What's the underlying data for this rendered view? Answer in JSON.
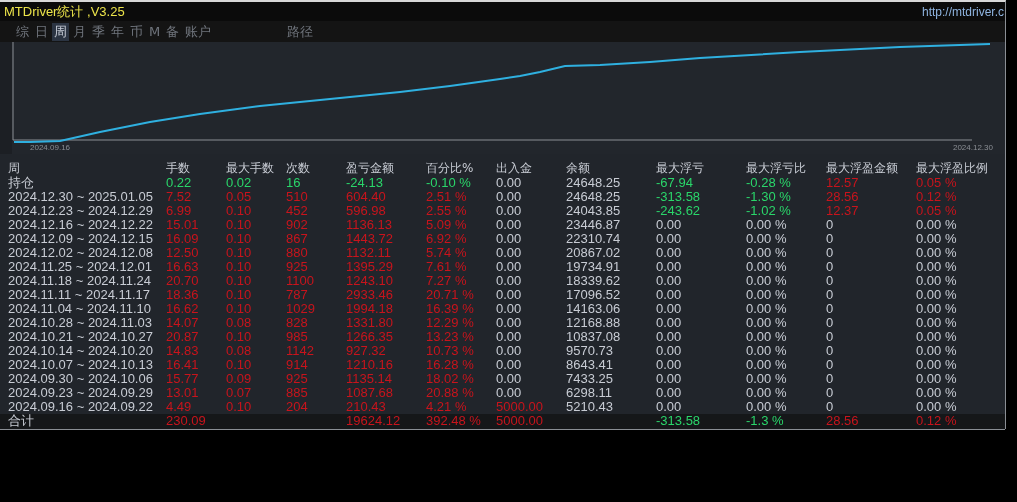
{
  "window": {
    "title": "MTDriver统计 ,V3.25",
    "url": "http://mtdriver.c"
  },
  "tabs": [
    {
      "label": "综",
      "selected": false
    },
    {
      "label": "日",
      "selected": false
    },
    {
      "label": "周",
      "selected": true
    },
    {
      "label": "月",
      "selected": false
    },
    {
      "label": "季",
      "selected": false
    },
    {
      "label": "年",
      "selected": false
    },
    {
      "label": "币",
      "selected": false
    },
    {
      "label": "M",
      "selected": false
    },
    {
      "label": "备",
      "selected": false
    },
    {
      "label": "账户",
      "selected": false
    },
    {
      "label": "路径",
      "selected": false
    }
  ],
  "chart": {
    "start_label": "2024.09.16",
    "end_label": "2024.12.30"
  },
  "table": {
    "columns": [
      "周",
      "手数",
      "最大手数",
      "次数",
      "盈亏金额",
      "百分比%",
      "出入金",
      "余额",
      "最大浮亏",
      "最大浮亏比",
      "最大浮盈金额",
      "最大浮盈比例"
    ],
    "rows": [
      {
        "cells": [
          "持仓",
          {
            "text": "0.22",
            "color": "#2ad66a"
          },
          {
            "text": "0.02",
            "color": "#2ad66a"
          },
          {
            "text": "16",
            "color": "#2ad66a"
          },
          {
            "text": "-24.13",
            "color": "#2ad66a"
          },
          {
            "text": "-0.10 %",
            "color": "#2ad66a"
          },
          {
            "text": "0.00",
            "color": "#c8ccd4"
          },
          {
            "text": "24648.25",
            "color": "#c8ccd4"
          },
          {
            "text": "-67.94",
            "color": "#2ad66a"
          },
          {
            "text": "-0.28 %",
            "color": "#2ad66a"
          },
          {
            "text": "12.57",
            "color": "#c8141c"
          },
          {
            "text": "0.05 %",
            "color": "#c8141c"
          }
        ]
      },
      {
        "cells": [
          "2024.12.30 ~ 2025.01.05",
          {
            "text": "7.52",
            "color": "#c8141c"
          },
          {
            "text": "0.05",
            "color": "#c8141c"
          },
          {
            "text": "510",
            "color": "#c8141c"
          },
          {
            "text": "604.40",
            "color": "#c8141c"
          },
          {
            "text": "2.51 %",
            "color": "#c8141c"
          },
          {
            "text": "0.00",
            "color": "#c8ccd4"
          },
          {
            "text": "24648.25",
            "color": "#c8ccd4"
          },
          {
            "text": "-313.58",
            "color": "#2ad66a"
          },
          {
            "text": "-1.30 %",
            "color": "#2ad66a"
          },
          {
            "text": "28.56",
            "color": "#c8141c"
          },
          {
            "text": "0.12 %",
            "color": "#c8141c"
          }
        ]
      },
      {
        "cells": [
          "2024.12.23 ~ 2024.12.29",
          {
            "text": "6.99",
            "color": "#c8141c"
          },
          {
            "text": "0.10",
            "color": "#c8141c"
          },
          {
            "text": "452",
            "color": "#c8141c"
          },
          {
            "text": "596.98",
            "color": "#c8141c"
          },
          {
            "text": "2.55 %",
            "color": "#c8141c"
          },
          {
            "text": "0.00",
            "color": "#c8ccd4"
          },
          {
            "text": "24043.85",
            "color": "#c8ccd4"
          },
          {
            "text": "-243.62",
            "color": "#2ad66a"
          },
          {
            "text": "-1.02 %",
            "color": "#2ad66a"
          },
          {
            "text": "12.37",
            "color": "#c8141c"
          },
          {
            "text": "0.05 %",
            "color": "#c8141c"
          }
        ]
      },
      {
        "cells": [
          "2024.12.16 ~ 2024.12.22",
          {
            "text": "15.01",
            "color": "#c8141c"
          },
          {
            "text": "0.10",
            "color": "#c8141c"
          },
          {
            "text": "902",
            "color": "#c8141c"
          },
          {
            "text": "1136.13",
            "color": "#c8141c"
          },
          {
            "text": "5.09 %",
            "color": "#c8141c"
          },
          {
            "text": "0.00",
            "color": "#c8ccd4"
          },
          {
            "text": "23446.87",
            "color": "#c8ccd4"
          },
          {
            "text": "0.00",
            "color": "#c8ccd4"
          },
          {
            "text": "0.00 %",
            "color": "#c8ccd4"
          },
          {
            "text": "0",
            "color": "#c8ccd4"
          },
          {
            "text": "0.00 %",
            "color": "#c8ccd4"
          }
        ]
      },
      {
        "cells": [
          "2024.12.09 ~ 2024.12.15",
          {
            "text": "16.09",
            "color": "#c8141c"
          },
          {
            "text": "0.10",
            "color": "#c8141c"
          },
          {
            "text": "867",
            "color": "#c8141c"
          },
          {
            "text": "1443.72",
            "color": "#c8141c"
          },
          {
            "text": "6.92 %",
            "color": "#c8141c"
          },
          {
            "text": "0.00",
            "color": "#c8ccd4"
          },
          {
            "text": "22310.74",
            "color": "#c8ccd4"
          },
          {
            "text": "0.00",
            "color": "#c8ccd4"
          },
          {
            "text": "0.00 %",
            "color": "#c8ccd4"
          },
          {
            "text": "0",
            "color": "#c8ccd4"
          },
          {
            "text": "0.00 %",
            "color": "#c8ccd4"
          }
        ]
      },
      {
        "cells": [
          "2024.12.02 ~ 2024.12.08",
          {
            "text": "12.50",
            "color": "#c8141c"
          },
          {
            "text": "0.10",
            "color": "#c8141c"
          },
          {
            "text": "880",
            "color": "#c8141c"
          },
          {
            "text": "1132.11",
            "color": "#c8141c"
          },
          {
            "text": "5.74 %",
            "color": "#c8141c"
          },
          {
            "text": "0.00",
            "color": "#c8ccd4"
          },
          {
            "text": "20867.02",
            "color": "#c8ccd4"
          },
          {
            "text": "0.00",
            "color": "#c8ccd4"
          },
          {
            "text": "0.00 %",
            "color": "#c8ccd4"
          },
          {
            "text": "0",
            "color": "#c8ccd4"
          },
          {
            "text": "0.00 %",
            "color": "#c8ccd4"
          }
        ]
      },
      {
        "cells": [
          "2024.11.25 ~ 2024.12.01",
          {
            "text": "16.63",
            "color": "#c8141c"
          },
          {
            "text": "0.10",
            "color": "#c8141c"
          },
          {
            "text": "925",
            "color": "#c8141c"
          },
          {
            "text": "1395.29",
            "color": "#c8141c"
          },
          {
            "text": "7.61 %",
            "color": "#c8141c"
          },
          {
            "text": "0.00",
            "color": "#c8ccd4"
          },
          {
            "text": "19734.91",
            "color": "#c8ccd4"
          },
          {
            "text": "0.00",
            "color": "#c8ccd4"
          },
          {
            "text": "0.00 %",
            "color": "#c8ccd4"
          },
          {
            "text": "0",
            "color": "#c8ccd4"
          },
          {
            "text": "0.00 %",
            "color": "#c8ccd4"
          }
        ]
      },
      {
        "cells": [
          "2024.11.18 ~ 2024.11.24",
          {
            "text": "20.70",
            "color": "#c8141c"
          },
          {
            "text": "0.10",
            "color": "#c8141c"
          },
          {
            "text": "1100",
            "color": "#c8141c"
          },
          {
            "text": "1243.10",
            "color": "#c8141c"
          },
          {
            "text": "7.27 %",
            "color": "#c8141c"
          },
          {
            "text": "0.00",
            "color": "#c8ccd4"
          },
          {
            "text": "18339.62",
            "color": "#c8ccd4"
          },
          {
            "text": "0.00",
            "color": "#c8ccd4"
          },
          {
            "text": "0.00 %",
            "color": "#c8ccd4"
          },
          {
            "text": "0",
            "color": "#c8ccd4"
          },
          {
            "text": "0.00 %",
            "color": "#c8ccd4"
          }
        ]
      },
      {
        "cells": [
          "2024.11.11 ~ 2024.11.17",
          {
            "text": "18.36",
            "color": "#c8141c"
          },
          {
            "text": "0.10",
            "color": "#c8141c"
          },
          {
            "text": "787",
            "color": "#c8141c"
          },
          {
            "text": "2933.46",
            "color": "#c8141c"
          },
          {
            "text": "20.71 %",
            "color": "#c8141c"
          },
          {
            "text": "0.00",
            "color": "#c8ccd4"
          },
          {
            "text": "17096.52",
            "color": "#c8ccd4"
          },
          {
            "text": "0.00",
            "color": "#c8ccd4"
          },
          {
            "text": "0.00 %",
            "color": "#c8ccd4"
          },
          {
            "text": "0",
            "color": "#c8ccd4"
          },
          {
            "text": "0.00 %",
            "color": "#c8ccd4"
          }
        ]
      },
      {
        "cells": [
          "2024.11.04 ~ 2024.11.10",
          {
            "text": "16.62",
            "color": "#c8141c"
          },
          {
            "text": "0.10",
            "color": "#c8141c"
          },
          {
            "text": "1029",
            "color": "#c8141c"
          },
          {
            "text": "1994.18",
            "color": "#c8141c"
          },
          {
            "text": "16.39 %",
            "color": "#c8141c"
          },
          {
            "text": "0.00",
            "color": "#c8ccd4"
          },
          {
            "text": "14163.06",
            "color": "#c8ccd4"
          },
          {
            "text": "0.00",
            "color": "#c8ccd4"
          },
          {
            "text": "0.00 %",
            "color": "#c8ccd4"
          },
          {
            "text": "0",
            "color": "#c8ccd4"
          },
          {
            "text": "0.00 %",
            "color": "#c8ccd4"
          }
        ]
      },
      {
        "cells": [
          "2024.10.28 ~ 2024.11.03",
          {
            "text": "14.07",
            "color": "#c8141c"
          },
          {
            "text": "0.08",
            "color": "#c8141c"
          },
          {
            "text": "828",
            "color": "#c8141c"
          },
          {
            "text": "1331.80",
            "color": "#c8141c"
          },
          {
            "text": "12.29 %",
            "color": "#c8141c"
          },
          {
            "text": "0.00",
            "color": "#c8ccd4"
          },
          {
            "text": "12168.88",
            "color": "#c8ccd4"
          },
          {
            "text": "0.00",
            "color": "#c8ccd4"
          },
          {
            "text": "0.00 %",
            "color": "#c8ccd4"
          },
          {
            "text": "0",
            "color": "#c8ccd4"
          },
          {
            "text": "0.00 %",
            "color": "#c8ccd4"
          }
        ]
      },
      {
        "cells": [
          "2024.10.21 ~ 2024.10.27",
          {
            "text": "20.87",
            "color": "#c8141c"
          },
          {
            "text": "0.10",
            "color": "#c8141c"
          },
          {
            "text": "985",
            "color": "#c8141c"
          },
          {
            "text": "1266.35",
            "color": "#c8141c"
          },
          {
            "text": "13.23 %",
            "color": "#c8141c"
          },
          {
            "text": "0.00",
            "color": "#c8ccd4"
          },
          {
            "text": "10837.08",
            "color": "#c8ccd4"
          },
          {
            "text": "0.00",
            "color": "#c8ccd4"
          },
          {
            "text": "0.00 %",
            "color": "#c8ccd4"
          },
          {
            "text": "0",
            "color": "#c8ccd4"
          },
          {
            "text": "0.00 %",
            "color": "#c8ccd4"
          }
        ]
      },
      {
        "cells": [
          "2024.10.14 ~ 2024.10.20",
          {
            "text": "14.83",
            "color": "#c8141c"
          },
          {
            "text": "0.08",
            "color": "#c8141c"
          },
          {
            "text": "1142",
            "color": "#c8141c"
          },
          {
            "text": "927.32",
            "color": "#c8141c"
          },
          {
            "text": "10.73 %",
            "color": "#c8141c"
          },
          {
            "text": "0.00",
            "color": "#c8ccd4"
          },
          {
            "text": "9570.73",
            "color": "#c8ccd4"
          },
          {
            "text": "0.00",
            "color": "#c8ccd4"
          },
          {
            "text": "0.00 %",
            "color": "#c8ccd4"
          },
          {
            "text": "0",
            "color": "#c8ccd4"
          },
          {
            "text": "0.00 %",
            "color": "#c8ccd4"
          }
        ]
      },
      {
        "cells": [
          "2024.10.07 ~ 2024.10.13",
          {
            "text": "16.41",
            "color": "#c8141c"
          },
          {
            "text": "0.10",
            "color": "#c8141c"
          },
          {
            "text": "914",
            "color": "#c8141c"
          },
          {
            "text": "1210.16",
            "color": "#c8141c"
          },
          {
            "text": "16.28 %",
            "color": "#c8141c"
          },
          {
            "text": "0.00",
            "color": "#c8ccd4"
          },
          {
            "text": "8643.41",
            "color": "#c8ccd4"
          },
          {
            "text": "0.00",
            "color": "#c8ccd4"
          },
          {
            "text": "0.00 %",
            "color": "#c8ccd4"
          },
          {
            "text": "0",
            "color": "#c8ccd4"
          },
          {
            "text": "0.00 %",
            "color": "#c8ccd4"
          }
        ]
      },
      {
        "cells": [
          "2024.09.30 ~ 2024.10.06",
          {
            "text": "15.77",
            "color": "#c8141c"
          },
          {
            "text": "0.09",
            "color": "#c8141c"
          },
          {
            "text": "925",
            "color": "#c8141c"
          },
          {
            "text": "1135.14",
            "color": "#c8141c"
          },
          {
            "text": "18.02 %",
            "color": "#c8141c"
          },
          {
            "text": "0.00",
            "color": "#c8ccd4"
          },
          {
            "text": "7433.25",
            "color": "#c8ccd4"
          },
          {
            "text": "0.00",
            "color": "#c8ccd4"
          },
          {
            "text": "0.00 %",
            "color": "#c8ccd4"
          },
          {
            "text": "0",
            "color": "#c8ccd4"
          },
          {
            "text": "0.00 %",
            "color": "#c8ccd4"
          }
        ]
      },
      {
        "cells": [
          "2024.09.23 ~ 2024.09.29",
          {
            "text": "13.01",
            "color": "#c8141c"
          },
          {
            "text": "0.07",
            "color": "#c8141c"
          },
          {
            "text": "885",
            "color": "#c8141c"
          },
          {
            "text": "1087.68",
            "color": "#c8141c"
          },
          {
            "text": "20.88 %",
            "color": "#c8141c"
          },
          {
            "text": "0.00",
            "color": "#c8ccd4"
          },
          {
            "text": "6298.11",
            "color": "#c8ccd4"
          },
          {
            "text": "0.00",
            "color": "#c8ccd4"
          },
          {
            "text": "0.00 %",
            "color": "#c8ccd4"
          },
          {
            "text": "0",
            "color": "#c8ccd4"
          },
          {
            "text": "0.00 %",
            "color": "#c8ccd4"
          }
        ]
      },
      {
        "cells": [
          "2024.09.16 ~ 2024.09.22",
          {
            "text": "4.49",
            "color": "#c8141c"
          },
          {
            "text": "0.10",
            "color": "#c8141c"
          },
          {
            "text": "204",
            "color": "#c8141c"
          },
          {
            "text": "210.43",
            "color": "#c8141c"
          },
          {
            "text": "4.21 %",
            "color": "#c8141c"
          },
          {
            "text": "5000.00",
            "color": "#c8141c"
          },
          {
            "text": "5210.43",
            "color": "#c8ccd4"
          },
          {
            "text": "0.00",
            "color": "#c8ccd4"
          },
          {
            "text": "0.00 %",
            "color": "#c8ccd4"
          },
          {
            "text": "0",
            "color": "#c8ccd4"
          },
          {
            "text": "0.00 %",
            "color": "#c8ccd4"
          }
        ]
      },
      {
        "total": true,
        "cells": [
          "合计",
          {
            "text": "230.09",
            "color": "#c8141c"
          },
          "",
          "",
          {
            "text": "19624.12",
            "color": "#c8141c"
          },
          {
            "text": "392.48 %",
            "color": "#c8141c"
          },
          {
            "text": "5000.00",
            "color": "#c8141c"
          },
          "",
          {
            "text": "-313.58",
            "color": "#2ad66a"
          },
          {
            "text": "-1.3 %",
            "color": "#2ad66a"
          },
          {
            "text": "28.56",
            "color": "#c8141c"
          },
          {
            "text": "0.12 %",
            "color": "#c8141c"
          }
        ]
      }
    ]
  }
}
